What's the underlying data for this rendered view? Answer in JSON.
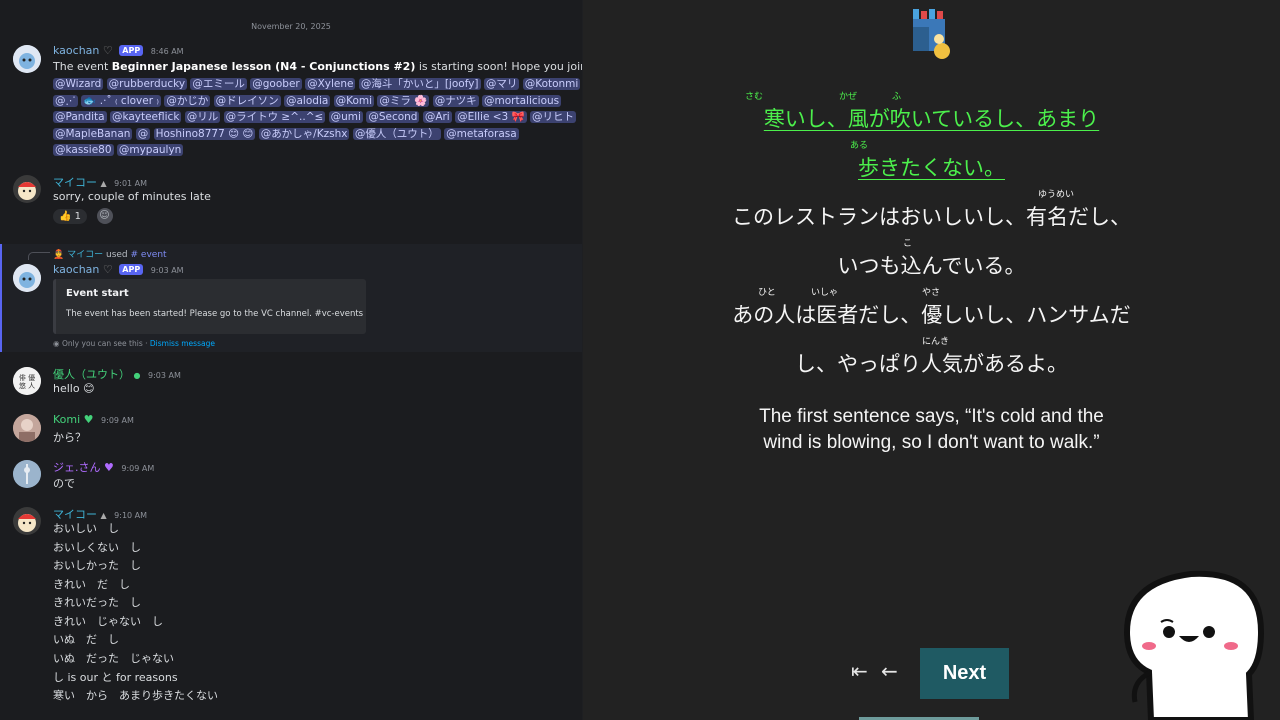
{
  "chat": {
    "date_divider": "November 20, 2025",
    "messages": [
      {
        "author": "kaochan",
        "badge": "APP",
        "time": "8:46 AM",
        "text_pre": "The event ",
        "text_bold": "Beginner Japanese lesson (N4 - Conjunctions #2)",
        "text_post": " is starting soon! Hope you join!",
        "mentions": [
          "@Wizard",
          "@rubberducky",
          "@エミール",
          "@goober",
          "@Xylene",
          "@海斗「かいと」[joofy]",
          "@マリ",
          "@Kotonmi",
          "@⋰",
          "🐟 .·˚ ₍ clover ₎",
          "@かじか",
          "@ドレイソン",
          "@alodia",
          "@Komi",
          "@ミラ 🌸",
          "@ナツキ",
          "@mortalicious",
          "@Pandita",
          "@kayteeflick",
          "@リル",
          "@ライトウ ≥^..^≤",
          "@umi",
          "@Second",
          "@Ari",
          "@Ellie <3 🎀",
          "@リヒト",
          "@MapleBanan",
          "@",
          "Hoshino8777 😊 😊",
          "@あかしゃ/Kzshx",
          "@優人（ユウト）",
          "@metaforasa",
          "@kassie80",
          "@mypaulyn"
        ]
      },
      {
        "author": "マイコー",
        "time": "9:01 AM",
        "text": "sorry, couple of minutes late",
        "reaction_emoji": "👍",
        "reaction_count": "1"
      },
      {
        "reply_author": "マイコー",
        "reply_used": "used",
        "reply_command": "# event",
        "author": "kaochan",
        "badge": "APP",
        "time": "9:03 AM",
        "embed_title": "Event start",
        "embed_body": "The event has been started! Please go to the VC channel. #vc-events",
        "ephemeral_note": "Only you can see this",
        "ephemeral_dismiss": "Dismiss message"
      },
      {
        "author": "優人（ユウト）",
        "time": "9:03 AM",
        "text": "hello"
      },
      {
        "author": "Komi",
        "time": "9:09 AM",
        "text": "から？"
      },
      {
        "author": "ジェ.さん",
        "time": "9:09 AM",
        "text": "ので"
      },
      {
        "author": "マイコー",
        "time": "9:10 AM",
        "lines": [
          "おいしい　し",
          "おいしくない　し",
          "おいしかった　し",
          "きれい　だ　し",
          "きれいだった　し",
          "きれい　じゃない　し",
          "いぬ　だ　し",
          "いぬ　だった　じゃない",
          "し is our と for reasons",
          "寒い　から　あまり歩きたくない"
        ]
      }
    ]
  },
  "slide": {
    "lines": [
      {
        "text": "寒いし、風が吹いているし、あまり",
        "highlight": true
      },
      {
        "text": "歩きたくない。",
        "highlight": true
      },
      {
        "text": "このレストランはおいしいし、有名だし、",
        "highlight": false
      },
      {
        "text": "いつも込んでいる。",
        "highlight": false
      },
      {
        "text": "あの人は医者だし、優しいし、ハンサムだ",
        "highlight": false
      },
      {
        "text": "し、やっぱり人気があるよ。",
        "highlight": false
      }
    ],
    "furigana": [
      "さむ",
      "かぜ",
      "ふ",
      "ある",
      "ゆうめい",
      "こ",
      "ひと",
      "いしゃ",
      "やさ",
      "にんき"
    ],
    "english_line1": "The first sentence says, “It's cold and the",
    "english_line2": "wind is blowing, so I don't want to walk.”",
    "first_label": "⇤",
    "back_label": "←",
    "next_label": "Next"
  },
  "colors": {
    "highlight_green": "#4cf04c",
    "next_button": "#1f5a63",
    "mention_bg": "#3c4270",
    "app_badge": "#5865f2"
  }
}
